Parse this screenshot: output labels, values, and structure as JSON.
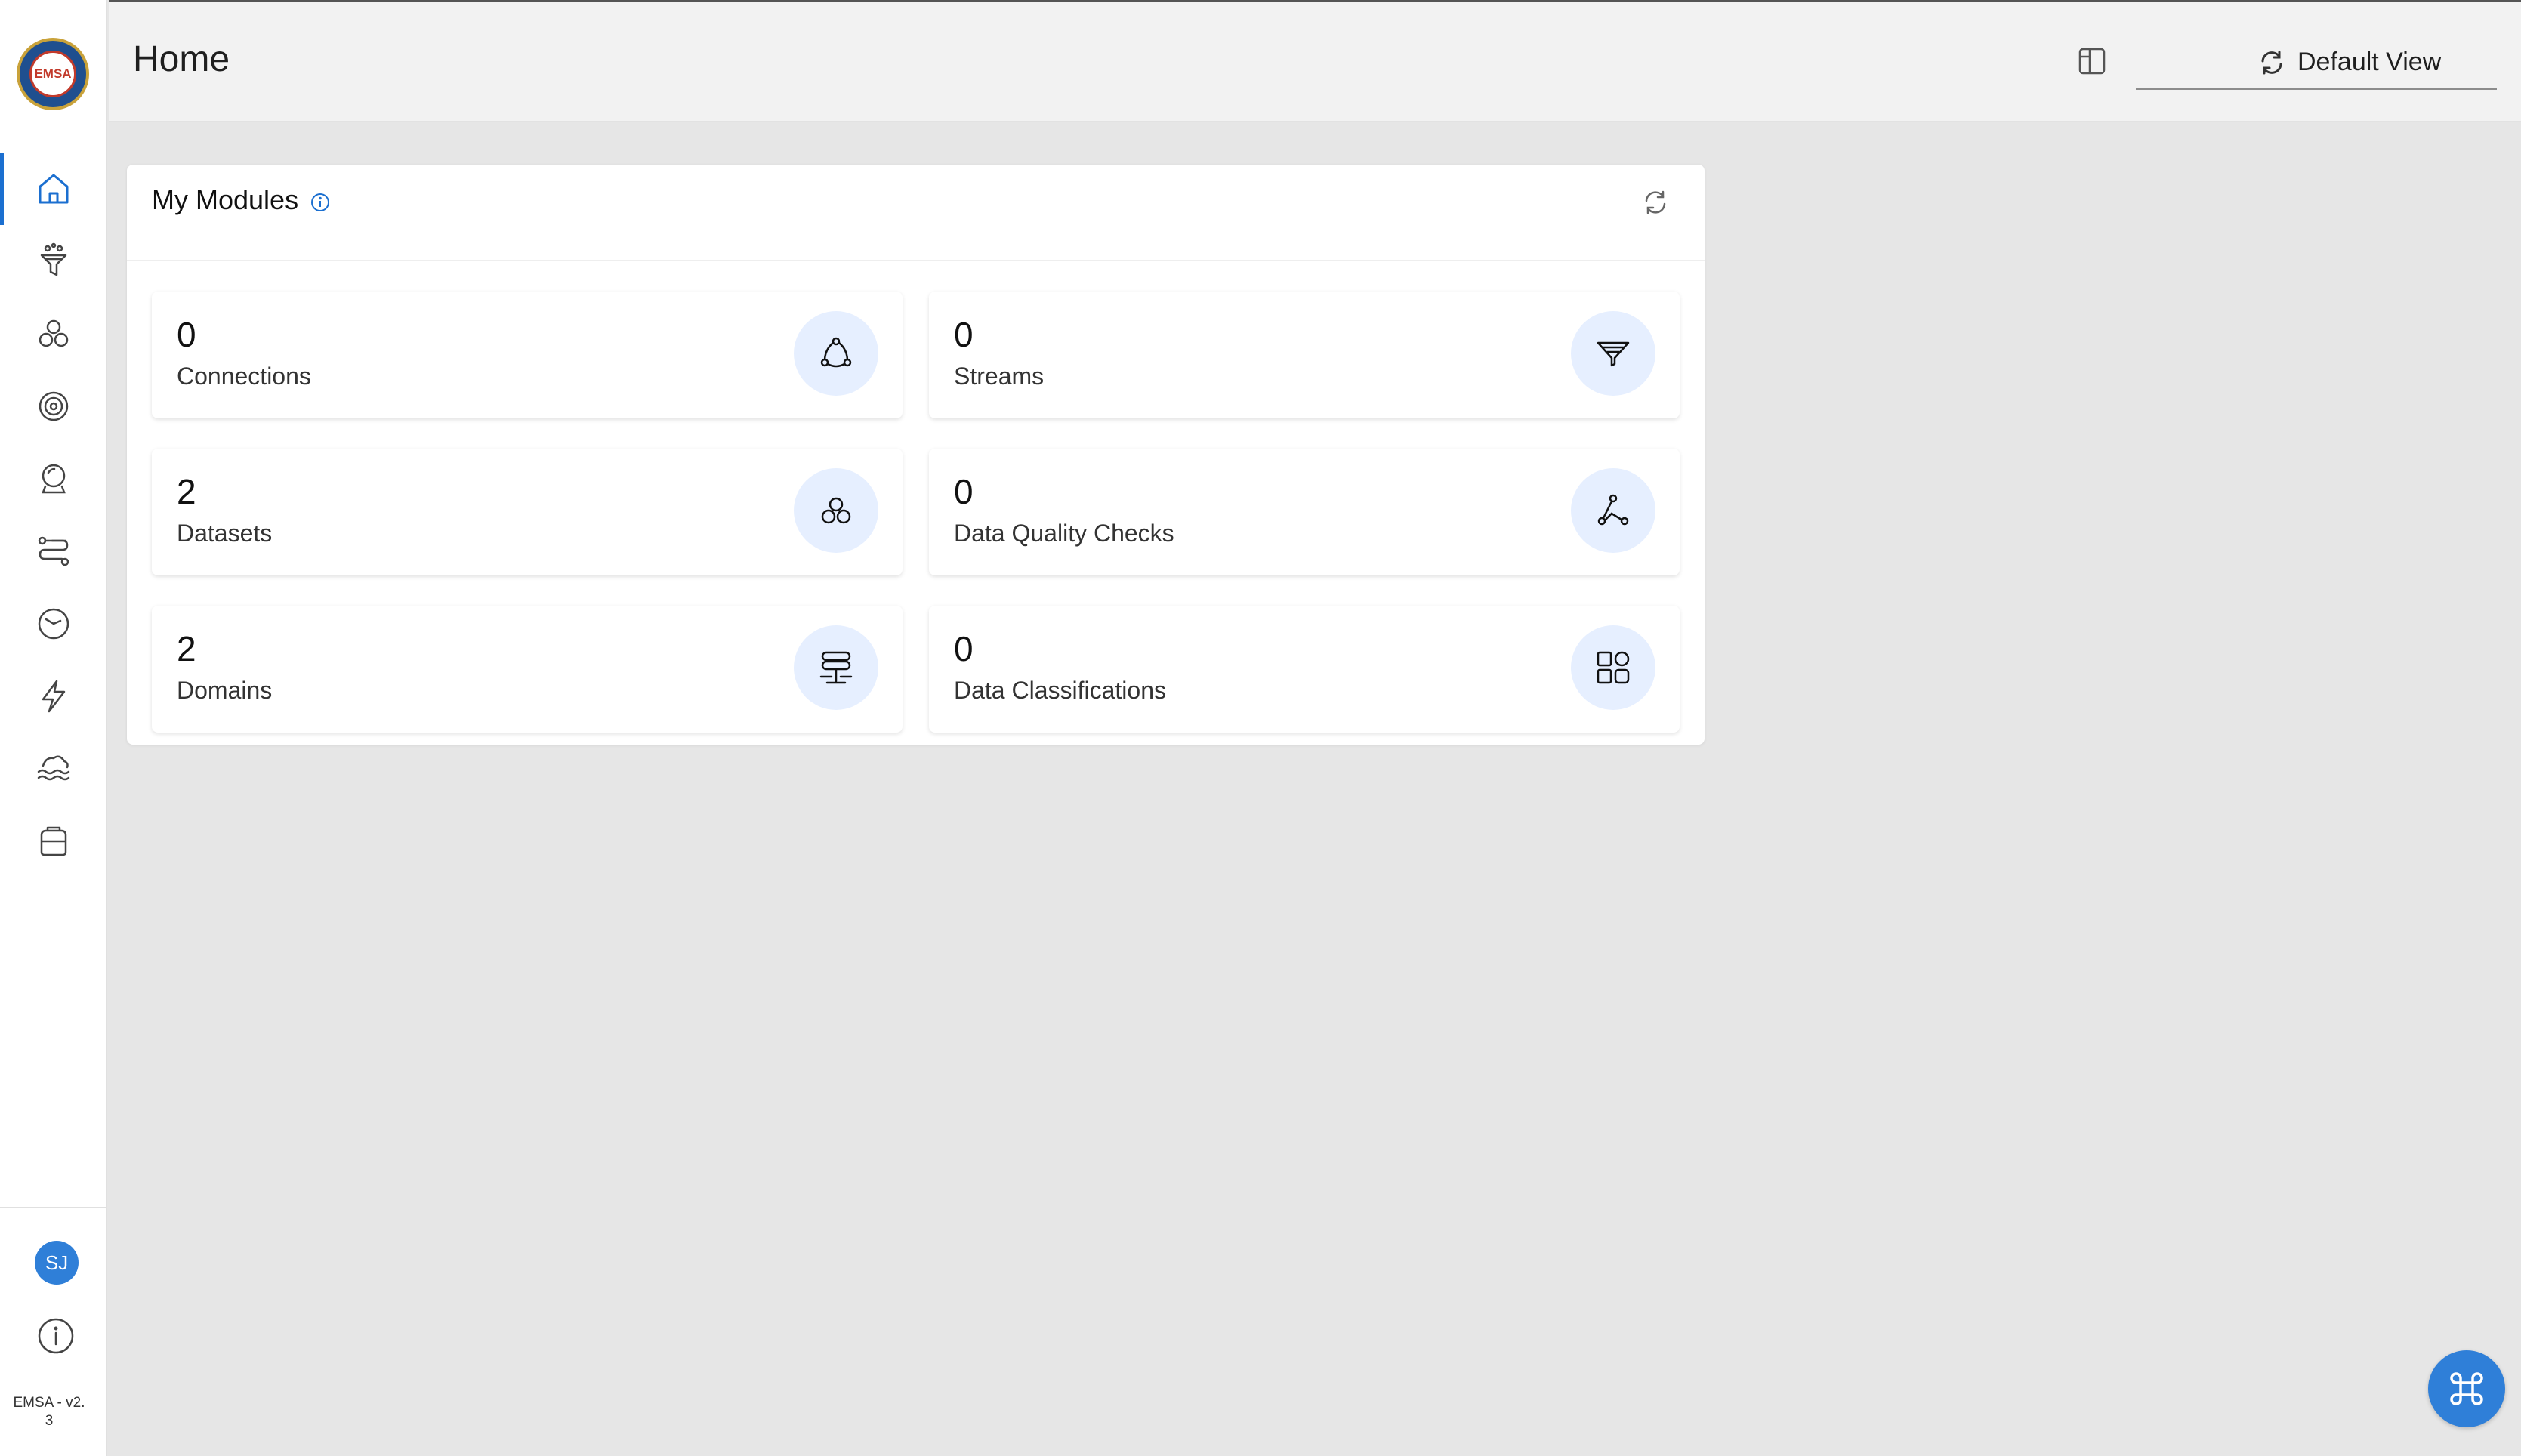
{
  "header": {
    "title": "Home",
    "view_label": "Default View"
  },
  "sidebar": {
    "logo_text": "EMSA",
    "items": [
      {
        "icon": "home-icon",
        "active": true
      },
      {
        "icon": "funnel-icon",
        "active": false
      },
      {
        "icon": "datasets-icon",
        "active": false
      },
      {
        "icon": "settings-gear-icon",
        "active": false
      },
      {
        "icon": "crystal-ball-icon",
        "active": false
      },
      {
        "icon": "pipeline-icon",
        "active": false
      },
      {
        "icon": "clock-icon",
        "active": false
      },
      {
        "icon": "lightning-icon",
        "active": false
      },
      {
        "icon": "data-lake-icon",
        "active": false
      },
      {
        "icon": "storage-icon",
        "active": false
      }
    ],
    "user_initials": "SJ",
    "version_line1": "EMSA - v2.",
    "version_line2": "3"
  },
  "modules": {
    "title": "My Modules",
    "tiles": [
      {
        "count": "0",
        "label": "Connections",
        "icon": "connections-icon"
      },
      {
        "count": "0",
        "label": "Streams",
        "icon": "streams-icon"
      },
      {
        "count": "2",
        "label": "Datasets",
        "icon": "datasets-icon"
      },
      {
        "count": "0",
        "label": "Data Quality Checks",
        "icon": "data-quality-icon"
      },
      {
        "count": "2",
        "label": "Domains",
        "icon": "domains-icon"
      },
      {
        "count": "0",
        "label": "Data Classifications",
        "icon": "data-classifications-icon"
      }
    ]
  },
  "colors": {
    "accent": "#1b6fd0",
    "avatar_bg": "#2f7fd8",
    "tile_icon_bg": "#e6efff",
    "page_bg": "#e6e6e6",
    "header_bg": "#f2f2f2"
  }
}
